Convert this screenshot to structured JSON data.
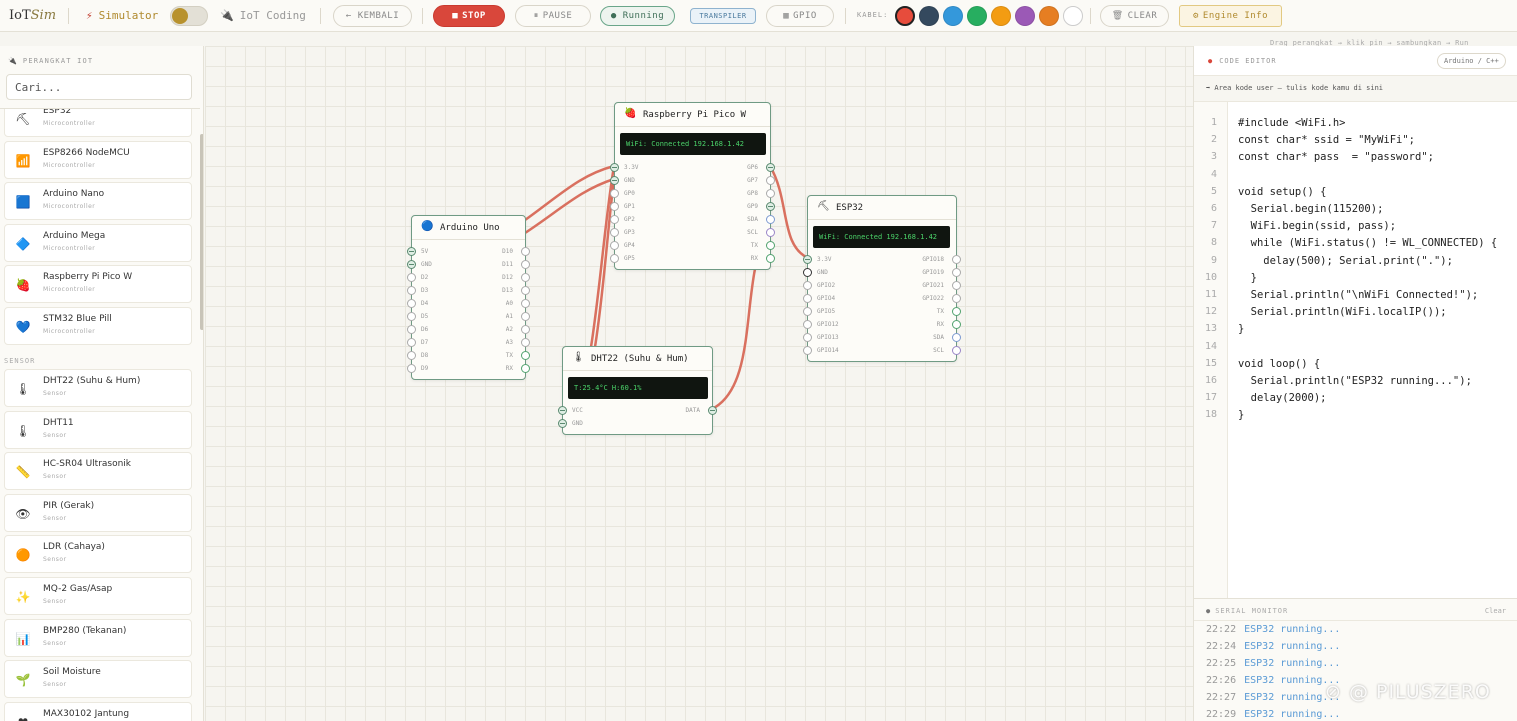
{
  "app": {
    "logo_main": "IoT",
    "logo_accent": "Sim"
  },
  "toolbar": {
    "mode_simulator": "Simulator",
    "mode_iot_coding": "IoT Coding",
    "back": "← KEMBALI",
    "stop": "STOP",
    "pause": "PAUSE",
    "running": "● Running",
    "transpiler": "TRANSPILER",
    "gpio": "GPIO",
    "kabel_label": "KABEL:",
    "clear": "CLEAR",
    "engine_info": "Engine Info",
    "wire_colors": [
      "#e74c3c",
      "#34495e",
      "#3498db",
      "#27ae60",
      "#f39c12",
      "#9b59b6",
      "#e67e22",
      "#ffffff"
    ],
    "selected_wire_color": "#e74c3c"
  },
  "hint": "Drag perangkat → klik pin → sambungkan → Run",
  "sidebar": {
    "heading": "PERANGKAT IOT",
    "search_placeholder": "Cari...",
    "categories": {
      "sensor": "SENSOR"
    },
    "microcontrollers": [
      {
        "name": "ESP32",
        "type": "Microcontroller",
        "icon": "chip-icon"
      },
      {
        "name": "ESP8266 NodeMCU",
        "type": "Microcontroller",
        "icon": "signal-icon"
      },
      {
        "name": "Arduino Nano",
        "type": "Microcontroller",
        "icon": "blue-square-icon"
      },
      {
        "name": "Arduino Mega",
        "type": "Microcontroller",
        "icon": "blue-diamond-icon"
      },
      {
        "name": "Raspberry Pi Pico W",
        "type": "Microcontroller",
        "icon": "raspberry-icon"
      },
      {
        "name": "STM32 Blue Pill",
        "type": "Microcontroller",
        "icon": "blue-heart-icon"
      }
    ],
    "sensors": [
      {
        "name": "DHT22 (Suhu & Hum)",
        "type": "Sensor",
        "icon": "thermometer-icon"
      },
      {
        "name": "DHT11",
        "type": "Sensor",
        "icon": "thermometer-icon"
      },
      {
        "name": "HC-SR04 Ultrasonik",
        "type": "Sensor",
        "icon": "ruler-icon"
      },
      {
        "name": "PIR (Gerak)",
        "type": "Sensor",
        "icon": "eye-icon"
      },
      {
        "name": "LDR (Cahaya)",
        "type": "Sensor",
        "icon": "sun-icon"
      },
      {
        "name": "MQ-2 Gas/Asap",
        "type": "Sensor",
        "icon": "smoke-icon"
      },
      {
        "name": "BMP280 (Tekanan)",
        "type": "Sensor",
        "icon": "chart-icon"
      },
      {
        "name": "Soil Moisture",
        "type": "Sensor",
        "icon": "seedling-icon"
      },
      {
        "name": "MAX30102 Jantung",
        "type": "Sensor",
        "icon": "heart-icon"
      }
    ]
  },
  "devices": {
    "arduino": {
      "title": "Arduino Uno",
      "left_pins": [
        "5V",
        "GND",
        "D2",
        "D3",
        "D4",
        "D5",
        "D6",
        "D7",
        "D8",
        "D9"
      ],
      "right_pins": [
        "D10",
        "D11",
        "D12",
        "D13",
        "A0",
        "A1",
        "A2",
        "A3",
        "TX",
        "RX"
      ]
    },
    "pico": {
      "title": "Raspberry Pi Pico W",
      "lcd": "WiFi: Connected 192.168.1.42",
      "left_pins": [
        "3.3V",
        "GND",
        "GP0",
        "GP1",
        "GP2",
        "GP3",
        "GP4",
        "GP5"
      ],
      "right_pins": [
        "GP6",
        "GP7",
        "GP8",
        "GP9",
        "SDA",
        "SCL",
        "TX",
        "RX"
      ]
    },
    "esp32": {
      "title": "ESP32",
      "lcd": "WiFi: Connected 192.168.1.42",
      "left_pins": [
        "3.3V",
        "GND",
        "GPIO2",
        "GPIO4",
        "GPIO5",
        "GPIO12",
        "GPIO13",
        "GPIO14"
      ],
      "right_pins": [
        "GPIO18",
        "GPIO19",
        "GPIO21",
        "GPIO22",
        "TX",
        "RX",
        "SDA",
        "SCL"
      ]
    },
    "dht22": {
      "title": "DHT22 (Suhu & Hum)",
      "lcd": "T:25.4°C H:60.1%",
      "left_pins": [
        "VCC",
        "GND"
      ],
      "right_pins": [
        "DATA"
      ]
    }
  },
  "editor": {
    "title": "CODE EDITOR",
    "language": "Arduino / C++",
    "subheader": "➡ Area kode user — tulis kode kamu di sini",
    "lines": [
      "#include <WiFi.h>",
      "const char* ssid = \"MyWiFi\";",
      "const char* pass  = \"password\";",
      "",
      "void setup() {",
      "  Serial.begin(115200);",
      "  WiFi.begin(ssid, pass);",
      "  while (WiFi.status() != WL_CONNECTED) {",
      "    delay(500); Serial.print(\".\");",
      "  }",
      "  Serial.println(\"\\nWiFi Connected!\");",
      "  Serial.println(WiFi.localIP());",
      "}",
      "",
      "void loop() {",
      "  Serial.println(\"ESP32 running...\");",
      "  delay(2000);",
      "}"
    ]
  },
  "serial": {
    "title": "SERIAL MONITOR",
    "clear": "Clear",
    "lines": [
      {
        "time": "22:22",
        "msg": "ESP32 running..."
      },
      {
        "time": "22:24",
        "msg": "ESP32 running..."
      },
      {
        "time": "22:25",
        "msg": "ESP32 running..."
      },
      {
        "time": "22:26",
        "msg": "ESP32 running..."
      },
      {
        "time": "22:27",
        "msg": "ESP32 running..."
      },
      {
        "time": "22:29",
        "msg": "ESP32 running..."
      }
    ]
  },
  "watermark": "⊘ @ PILUSZERO"
}
